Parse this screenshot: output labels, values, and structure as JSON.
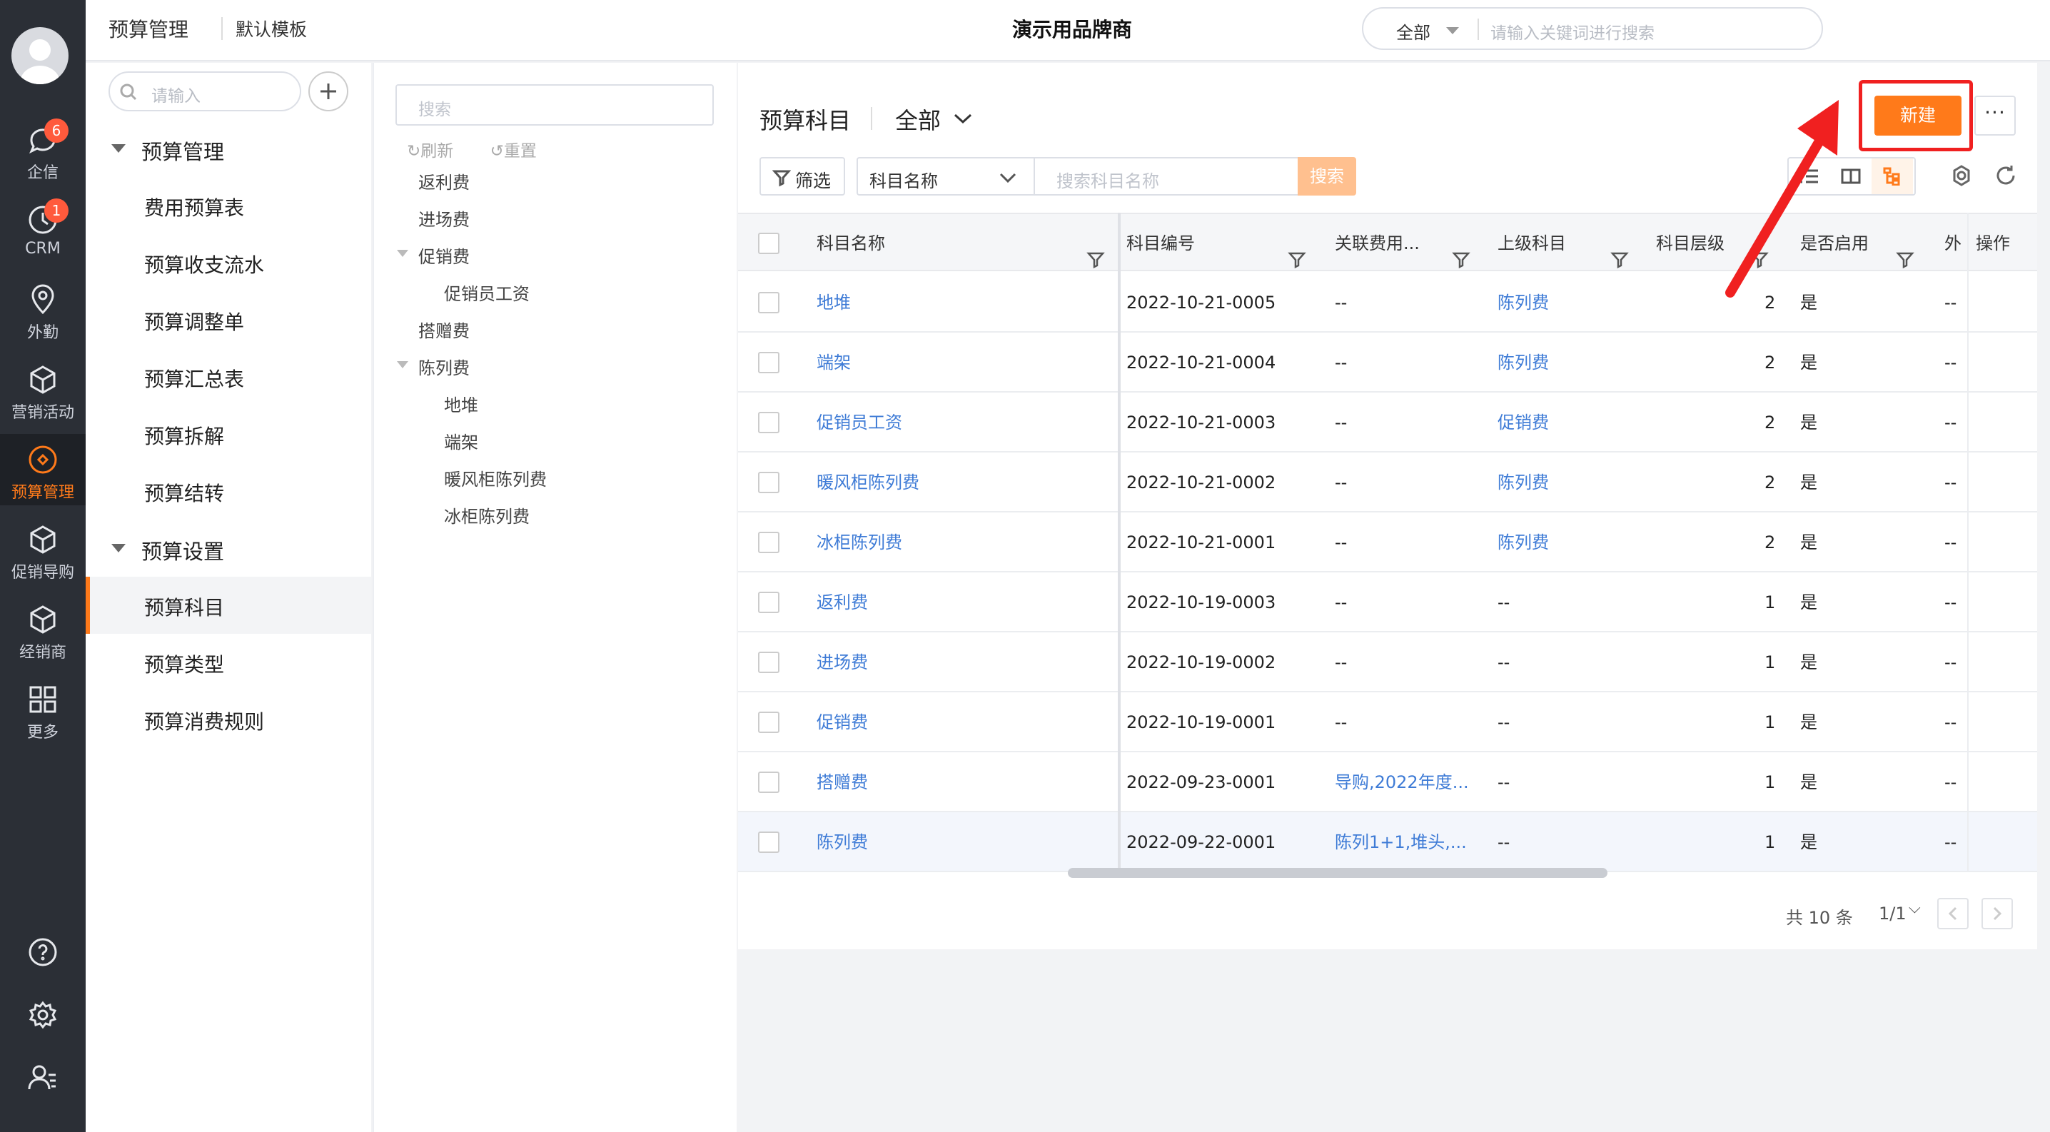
{
  "rail": {
    "items": [
      {
        "label": "企信",
        "icon": "chat-icon",
        "badge": "6"
      },
      {
        "label": "CRM",
        "icon": "clock-icon",
        "badge": "1"
      },
      {
        "label": "外勤",
        "icon": "location-icon",
        "badge": ""
      },
      {
        "label": "营销活动",
        "icon": "cube-icon",
        "badge": ""
      },
      {
        "label": "预算管理",
        "icon": "budget-icon",
        "badge": "",
        "active": true
      },
      {
        "label": "促销导购",
        "icon": "cube-icon",
        "badge": ""
      },
      {
        "label": "经销商",
        "icon": "cube-icon",
        "badge": ""
      },
      {
        "label": "更多",
        "icon": "grid-icon",
        "badge": ""
      }
    ],
    "accent": "#ff7a1a"
  },
  "topbar": {
    "module": "预算管理",
    "template": "默认模板",
    "brand": "演示用品牌商",
    "search_scope": "全部",
    "search_placeholder": "请输入关键词进行搜索"
  },
  "menu": {
    "search_placeholder": "请输入",
    "groups": [
      {
        "label": "预算管理",
        "items": [
          "费用预算表",
          "预算收支流水",
          "预算调整单",
          "预算汇总表",
          "预算拆解",
          "预算结转"
        ]
      },
      {
        "label": "预算设置",
        "items": [
          "预算科目",
          "预算类型",
          "预算消费规则"
        ]
      }
    ],
    "active_item": "预算科目"
  },
  "tree": {
    "search_placeholder": "搜索",
    "refresh_label": "刷新",
    "reset_label": "重置",
    "nodes": [
      {
        "label": "返利费",
        "level": 0,
        "expandable": false
      },
      {
        "label": "进场费",
        "level": 0,
        "expandable": false
      },
      {
        "label": "促销费",
        "level": 0,
        "expandable": true
      },
      {
        "label": "促销员工资",
        "level": 1,
        "expandable": false
      },
      {
        "label": "搭赠费",
        "level": 0,
        "expandable": false
      },
      {
        "label": "陈列费",
        "level": 0,
        "expandable": true
      },
      {
        "label": "地堆",
        "level": 1,
        "expandable": false
      },
      {
        "label": "端架",
        "level": 1,
        "expandable": false
      },
      {
        "label": "暖风柜陈列费",
        "level": 1,
        "expandable": false
      },
      {
        "label": "冰柜陈列费",
        "level": 1,
        "expandable": false
      }
    ]
  },
  "main": {
    "title": "预算科目",
    "scope": "全部",
    "new_label": "新建",
    "more_label": "···",
    "filter_label": "筛选",
    "field_select": "科目名称",
    "field_placeholder": "搜索科目名称",
    "search_label": "搜索",
    "columns": [
      "科目名称",
      "科目编号",
      "关联费用...",
      "上级科目",
      "科目层级",
      "是否启用",
      "外部",
      "操作"
    ],
    "rows": [
      {
        "name": "地堆",
        "code": "2022-10-21-0005",
        "related": "--",
        "parent": "陈列费",
        "level": "2",
        "enabled": "是",
        "ext": "--"
      },
      {
        "name": "端架",
        "code": "2022-10-21-0004",
        "related": "--",
        "parent": "陈列费",
        "level": "2",
        "enabled": "是",
        "ext": "--"
      },
      {
        "name": "促销员工资",
        "code": "2022-10-21-0003",
        "related": "--",
        "parent": "促销费",
        "level": "2",
        "enabled": "是",
        "ext": "--"
      },
      {
        "name": "暖风柜陈列费",
        "code": "2022-10-21-0002",
        "related": "--",
        "parent": "陈列费",
        "level": "2",
        "enabled": "是",
        "ext": "--"
      },
      {
        "name": "冰柜陈列费",
        "code": "2022-10-21-0001",
        "related": "--",
        "parent": "陈列费",
        "level": "2",
        "enabled": "是",
        "ext": "--"
      },
      {
        "name": "返利费",
        "code": "2022-10-19-0003",
        "related": "--",
        "parent": "--",
        "level": "1",
        "enabled": "是",
        "ext": "--"
      },
      {
        "name": "进场费",
        "code": "2022-10-19-0002",
        "related": "--",
        "parent": "--",
        "level": "1",
        "enabled": "是",
        "ext": "--"
      },
      {
        "name": "促销费",
        "code": "2022-10-19-0001",
        "related": "--",
        "parent": "--",
        "level": "1",
        "enabled": "是",
        "ext": "--"
      },
      {
        "name": "搭赠费",
        "code": "2022-09-23-0001",
        "related": "导购,2022年度...",
        "parent": "--",
        "level": "1",
        "enabled": "是",
        "ext": "--"
      },
      {
        "name": "陈列费",
        "code": "2022-09-22-0001",
        "related": "陈列1+1,堆头,...",
        "parent": "--",
        "level": "1",
        "enabled": "是",
        "ext": "--"
      }
    ],
    "total_label": "共 10 条",
    "page_label": "1/1"
  }
}
